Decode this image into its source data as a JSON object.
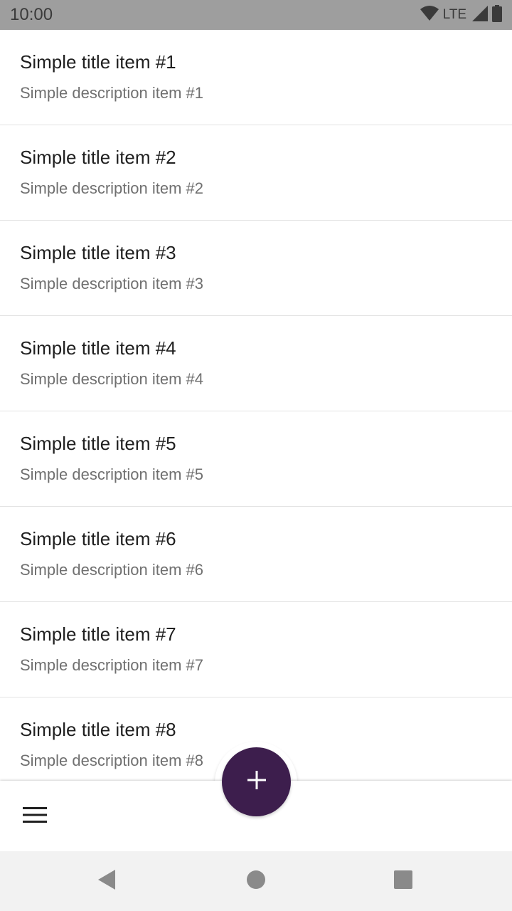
{
  "status_bar": {
    "time": "10:00",
    "network": "LTE",
    "icons": [
      "wifi-icon",
      "signal-icon",
      "battery-icon"
    ]
  },
  "list": {
    "items": [
      {
        "title": "Simple title item #1",
        "description": "Simple description item #1"
      },
      {
        "title": "Simple title item #2",
        "description": "Simple description item #2"
      },
      {
        "title": "Simple title item #3",
        "description": "Simple description item #3"
      },
      {
        "title": "Simple title item #4",
        "description": "Simple description item #4"
      },
      {
        "title": "Simple title item #5",
        "description": "Simple description item #5"
      },
      {
        "title": "Simple title item #6",
        "description": "Simple description item #6"
      },
      {
        "title": "Simple title item #7",
        "description": "Simple description item #7"
      },
      {
        "title": "Simple title item #8",
        "description": "Simple description item #8"
      }
    ]
  },
  "bottom_bar": {
    "menu_icon": "menu-icon",
    "fab_icon": "add-icon",
    "fab_color": "#3d1e4d"
  },
  "nav_bar": {
    "icons": [
      "back-icon",
      "home-icon",
      "recents-icon"
    ]
  },
  "colors": {
    "status_bar": "#9e9e9e",
    "title_text": "#1f1f1f",
    "description_text": "#707070",
    "divider": "#e2e2e2",
    "nav_bar": "#f2f2f2"
  }
}
